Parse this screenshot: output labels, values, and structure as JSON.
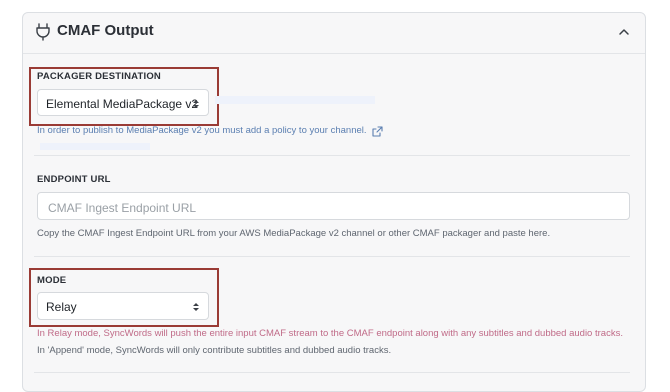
{
  "section": {
    "title": "CMAF Output",
    "icon": "plug-icon",
    "collapse_icon": "chevron-up-icon"
  },
  "packager": {
    "label": "PACKAGER DESTINATION",
    "selected": "Elemental MediaPackage v2",
    "help_text": "In order to publish to MediaPackage v2 you must add a policy to your channel."
  },
  "endpoint": {
    "label": "ENDPOINT URL",
    "placeholder": "CMAF Ingest Endpoint URL",
    "help_text": "Copy the CMAF Ingest Endpoint URL from your AWS MediaPackage v2 channel or other CMAF packager and paste here."
  },
  "mode": {
    "label": "MODE",
    "selected": "Relay",
    "help_line1": "In Relay mode, SyncWords will push the entire input CMAF stream to the CMAF endpoint along with any subtitles and dubbed audio tracks.",
    "help_line2": "In 'Append' mode, SyncWords will only contribute subtitles and dubbed audio tracks."
  },
  "colors": {
    "highlight_border": "#9a3b35",
    "link": "#5b7fb1"
  }
}
